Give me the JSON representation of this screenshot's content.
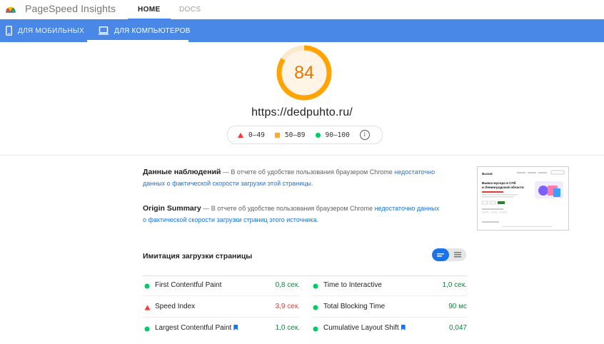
{
  "header": {
    "brand": "PageSpeed Insights",
    "nav": [
      {
        "label": "HOME"
      },
      {
        "label": "DOCS"
      }
    ]
  },
  "device_tabs": [
    {
      "label": "ДЛЯ МОБИЛЬНЫХ",
      "icon": "phone-icon"
    },
    {
      "label": "ДЛЯ КОМПЬЮТЕРОВ",
      "icon": "desktop-icon"
    }
  ],
  "score": {
    "value": "84",
    "fraction": 0.84,
    "color": "#ffa400"
  },
  "url": "https://dedpuhto.ru/",
  "legend": [
    {
      "range": "0–49",
      "color": "#ff3333",
      "shape": "triangle"
    },
    {
      "range": "50–89",
      "color": "#ffaa33",
      "shape": "square"
    },
    {
      "range": "90–100",
      "color": "#00cc66",
      "shape": "circle"
    }
  ],
  "field_data": {
    "title": "Данные наблюдений",
    "text": " — В отчете об удобстве пользования браузером Chrome ",
    "link": "недостаточно данных о фактической скорости загрузки этой страницы",
    "tail": "."
  },
  "origin_summary": {
    "title": "Origin Summary",
    "text": " — В отчете об удобстве пользования браузером Chrome ",
    "link": "недостаточно данных о фактической скорости загрузки страниц этого источника",
    "tail": "."
  },
  "thumbnail": {
    "logo": "Вызов",
    "headline_1": "Вывоз мусора в СПб",
    "headline_2": "и Ленинградской области"
  },
  "lab": {
    "title": "Имитация загрузки страницы",
    "metrics_left": [
      {
        "name": "First Contentful Paint",
        "value": "0,8 сек.",
        "status": "good"
      },
      {
        "name": "Speed Index",
        "value": "3,9 сек.",
        "status": "poor"
      },
      {
        "name": "Largest Contentful Paint",
        "value": "1,0 сек.",
        "status": "good",
        "flag": true
      }
    ],
    "metrics_right": [
      {
        "name": "Time to Interactive",
        "value": "1,0 сек.",
        "status": "good"
      },
      {
        "name": "Total Blocking Time",
        "value": "90 мс",
        "status": "good"
      },
      {
        "name": "Cumulative Layout Shift",
        "value": "0,047",
        "status": "good",
        "flag": true
      }
    ]
  }
}
